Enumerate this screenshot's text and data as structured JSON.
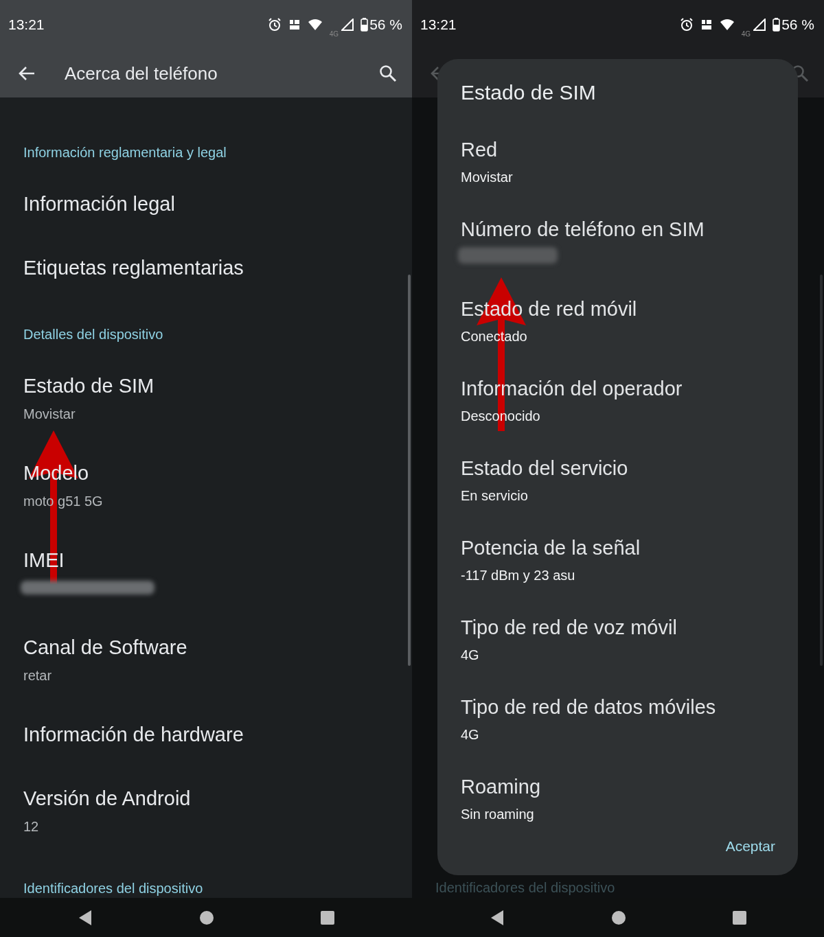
{
  "screens": [
    {
      "dimmed": false,
      "status_bar": {
        "time": "13:21",
        "network": "4G",
        "battery": "56 %"
      },
      "app_bar": {
        "title": "Acerca del teléfono"
      },
      "list": [
        {
          "kind": "header",
          "title": "Información reglamentaria y legal"
        },
        {
          "kind": "item",
          "title": "Información legal"
        },
        {
          "kind": "item",
          "title": "Etiquetas reglamentarias"
        },
        {
          "kind": "header",
          "title": "Detalles del dispositivo"
        },
        {
          "kind": "item",
          "title": "Estado de SIM",
          "summary": "Movistar"
        },
        {
          "kind": "item",
          "title": "Modelo",
          "summary": "moto g51 5G"
        },
        {
          "kind": "item",
          "title": "IMEI",
          "redacted": true
        },
        {
          "kind": "item",
          "title": "Canal de Software",
          "summary": "retar"
        },
        {
          "kind": "item",
          "title": "Información de hardware"
        },
        {
          "kind": "item",
          "title": "Versión de Android",
          "summary": "12"
        },
        {
          "kind": "header",
          "title": "Identificadores del dispositivo"
        }
      ],
      "annotations": [
        {
          "kind": "arrow"
        }
      ]
    },
    {
      "dimmed": true,
      "status_bar": {
        "time": "13:21",
        "network": "4G",
        "battery": "56 %"
      },
      "list": [
        {
          "kind": "header",
          "title": "Identificadores del dispositivo"
        }
      ],
      "dialog": {
        "title": "Estado de SIM",
        "items": [
          {
            "title": "Red",
            "summary": "Movistar"
          },
          {
            "title": "Número de teléfono en SIM",
            "redacted": true
          },
          {
            "title": "Estado de red móvil",
            "summary": "Conectado"
          },
          {
            "title": "Información del operador",
            "summary": "Desconocido"
          },
          {
            "title": "Estado del servicio",
            "summary": "En servicio"
          },
          {
            "title": "Potencia de la señal",
            "summary": "-117 dBm y 23 asu"
          },
          {
            "title": "Tipo de red de voz móvil",
            "summary": "4G"
          },
          {
            "title": "Tipo de red de datos móviles",
            "summary": "4G"
          },
          {
            "title": "Roaming",
            "summary": "Sin roaming"
          }
        ],
        "button": "Aceptar"
      },
      "annotations": [
        {
          "kind": "arrow"
        }
      ]
    }
  ]
}
